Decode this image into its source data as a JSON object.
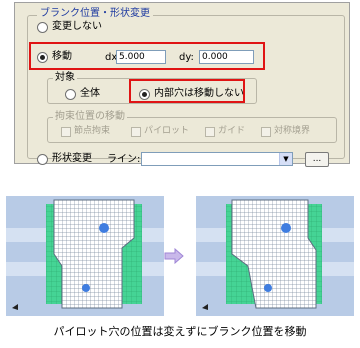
{
  "dialog": {
    "group_title": "ブランク位置・形状変更",
    "options": {
      "no_change": "変更しない",
      "move": "移動",
      "shape_change": "形状変更"
    },
    "dx_label": "dx:",
    "dx_value": "5.000",
    "dy_label": "dy:",
    "dy_value": "0.000",
    "target": {
      "title": "対象",
      "all": "全体",
      "inner_holes": "内部穴は移動しない"
    },
    "constraint": {
      "title": "拘束位置の移動",
      "items": [
        "節点拘束",
        "パイロット",
        "ガイド",
        "対称境界"
      ]
    },
    "line_label": "ライン:",
    "line_value": "",
    "browse_label": "..."
  },
  "colors": {
    "highlight": "#e01414",
    "mesh": "#7d8da0",
    "band": "#45d495",
    "background": "#b8cbe6",
    "hole": "#3f7de0"
  },
  "caption": "パイロット穴の位置は変えずにブランク位置を移動"
}
